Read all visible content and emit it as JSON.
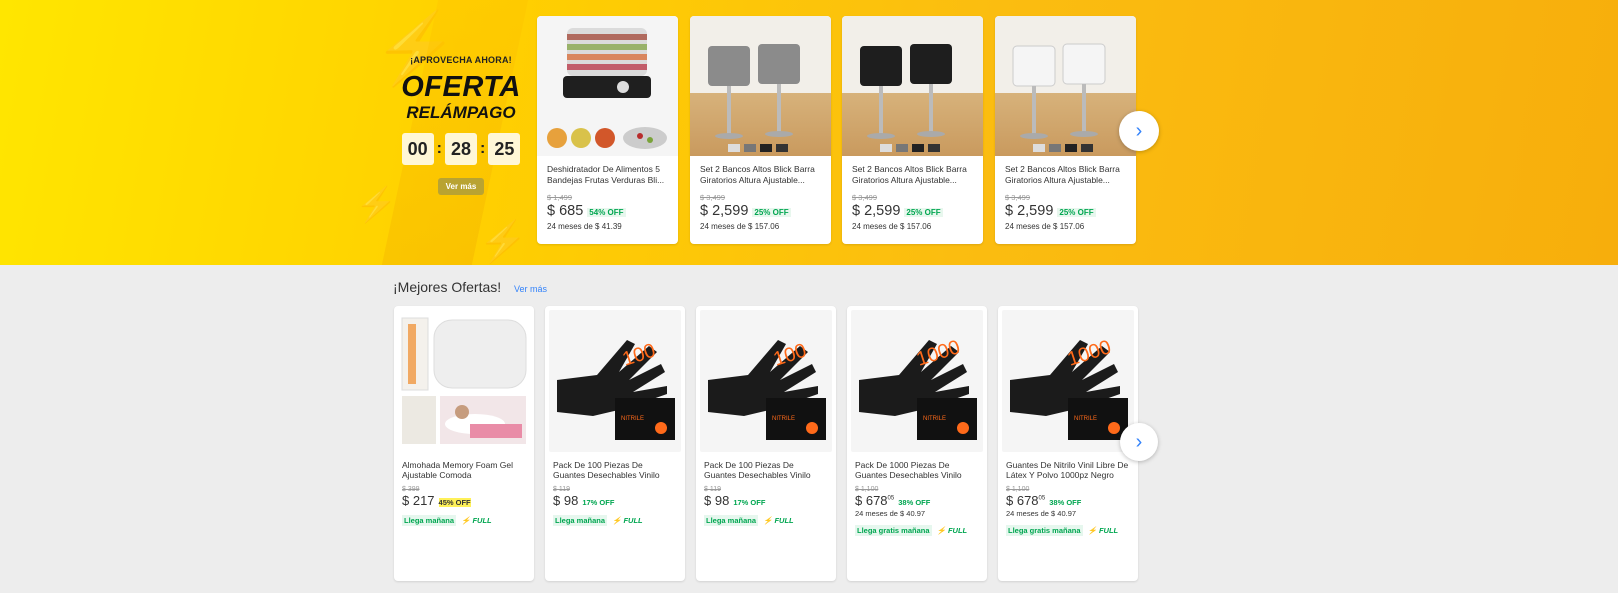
{
  "flash": {
    "kicker": "¡APROVECHA AHORA!",
    "title1": "OFERTA",
    "title2": "RELÁMPAGO",
    "timer": {
      "h": "00",
      "m": "28",
      "s": "25"
    },
    "cta": "Ver más",
    "cards": [
      {
        "title": "Deshidratador De Alimentos 5 Bandejas Frutas Verduras Bli...",
        "old": "$ 1,499",
        "price": "$ 685",
        "off": "54% OFF",
        "installments": "24 meses de $ 41.39"
      },
      {
        "title": "Set 2 Bancos Altos Blick Barra Giratorios Altura Ajustable...",
        "old": "$ 3,499",
        "price": "$ 2,599",
        "off": "25% OFF",
        "installments": "24 meses de $ 157.06"
      },
      {
        "title": "Set 2 Bancos Altos Blick Barra Giratorios Altura Ajustable...",
        "old": "$ 3,499",
        "price": "$ 2,599",
        "off": "25% OFF",
        "installments": "24 meses de $ 157.06"
      },
      {
        "title": "Set 2 Bancos Altos Blick Barra Giratorios Altura Ajustable...",
        "old": "$ 3,499",
        "price": "$ 2,599",
        "off": "25% OFF",
        "installments": "24 meses de $ 157.06"
      }
    ]
  },
  "offers": {
    "title": "¡Mejores Ofertas!",
    "link": "Ver más",
    "cards": [
      {
        "title": "Almohada Memory Foam Gel Ajustable Comoda Ergonomica...",
        "old": "$ 399",
        "price": "$ 217",
        "off": "45% OFF",
        "installments": "",
        "shipping": "Llega mañana",
        "full": "FULL"
      },
      {
        "title": "Pack De 100 Piezas De Guantes Desechables Vinilo Negro Sin...",
        "old": "$ 119",
        "price": "$ 98",
        "off": "17% OFF",
        "installments": "",
        "shipping": "Llega mañana",
        "full": "FULL"
      },
      {
        "title": "Pack De 100 Piezas De Guantes Desechables Vinilo Negro Sin...",
        "old": "$ 119",
        "price": "$ 98",
        "off": "17% OFF",
        "installments": "",
        "shipping": "Llega mañana",
        "full": "FULL"
      },
      {
        "title": "Pack De 1000 Piezas De Guantes Desechables Vinilo Negro Sin...",
        "old": "$ 1,100",
        "price": "$ 678",
        "cents": "05",
        "off": "38% OFF",
        "installments": "24 meses de $ 40.97",
        "shipping": "Llega gratis mañana",
        "full": "FULL"
      },
      {
        "title": "Guantes De Nitrilo Vinil Libre De Látex Y Polvo 1000pz Negro Tal...",
        "old": "$ 1,100",
        "price": "$ 678",
        "cents": "05",
        "off": "38% OFF",
        "installments": "24 meses de $ 40.97",
        "shipping": "Llega gratis mañana",
        "full": "FULL"
      }
    ]
  },
  "icons": {
    "next": "chevron-right-icon",
    "full": "lightning-icon"
  },
  "colors": {
    "accent": "#3483fa",
    "discount": "#00a650",
    "flash_bg": "#ffd000"
  }
}
